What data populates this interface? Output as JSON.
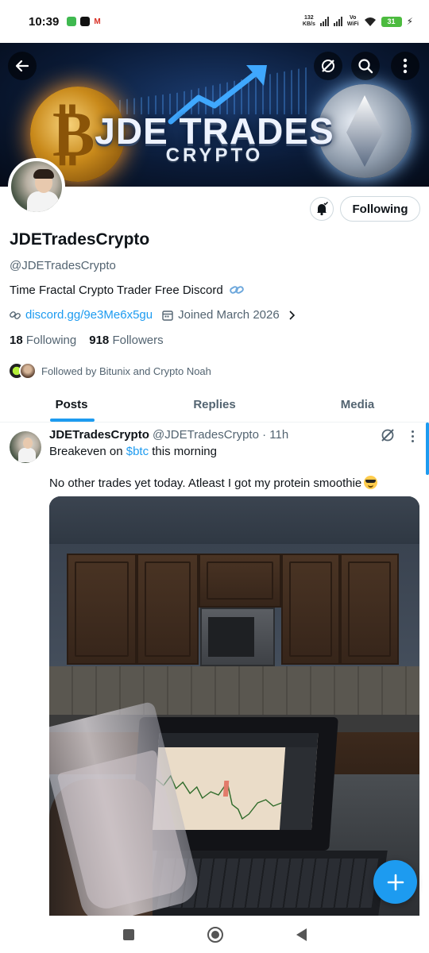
{
  "status_bar": {
    "time": "10:39",
    "speed_value": "132",
    "speed_unit": "KB/s",
    "vowifi_top": "Vo",
    "vowifi_bottom": "WiFi",
    "battery": "31"
  },
  "banner": {
    "brand_title": "JDE TRADES",
    "brand_subtitle": "CRYPTO",
    "back_icon": "back-arrow-icon",
    "grok_icon": "grok-icon",
    "search_icon": "search-icon",
    "more_icon": "more-vertical-icon"
  },
  "profile": {
    "following_button": "Following",
    "display_name": "JDETradesCrypto",
    "handle": "@JDETradesCrypto",
    "bio": "Time Fractal Crypto Trader  Free Discord",
    "url": "discord.gg/9e3Me6x5gu",
    "joined": "Joined March 2026",
    "following_count": "18",
    "following_label": "Following",
    "followers_count": "918",
    "followers_label": "Followers",
    "followed_by": "Followed by Bitunix and Crypto Noah"
  },
  "tabs": [
    {
      "label": "Posts",
      "active": true
    },
    {
      "label": "Replies",
      "active": false
    },
    {
      "label": "Media",
      "active": false
    }
  ],
  "tweet": {
    "name": "JDETradesCrypto",
    "handle": "@JDETradesCrypto",
    "time": "· 11h",
    "line1_pre": "Breakeven on ",
    "line1_cashtag": "$btc",
    "line1_post": " this morning",
    "line2": "No other trades yet today.  Atleast I got my protein smoothie"
  },
  "colors": {
    "accent": "#1d9bf0",
    "text": "#0f1419",
    "secondary": "#536471"
  }
}
